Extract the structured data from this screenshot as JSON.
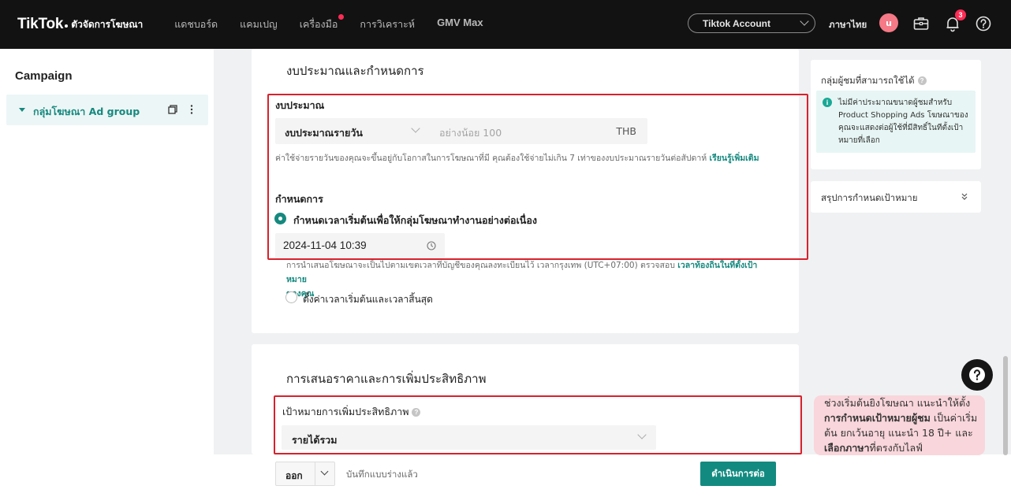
{
  "topbar": {
    "logo": "TikTok",
    "logo_sub": "ตัวจัดการโฆษณา",
    "nav": [
      "แดชบอร์ด",
      "แคมเปญ",
      "เครื่องมือ",
      "การวิเคราะห์",
      "GMV Max"
    ],
    "account": "Tiktok Account",
    "language": "ภาษาไทย",
    "avatar_initial": "u",
    "notification_count": "3"
  },
  "sidebar": {
    "title": "Campaign",
    "item_label": "กลุ่มโฆษณา Ad group"
  },
  "budget_section": {
    "title": "งบประมาณและกำหนดการ",
    "budget_label": "งบประมาณ",
    "budget_type": "งบประมาณรายวัน",
    "amount_placeholder": "อย่างน้อย 100",
    "currency": "THB",
    "budget_hint": "ค่าใช้จ่ายรายวันของคุณจะขึ้นอยู่กับโอกาสในการโฆษณาที่มี คุณต้องใช้จ่ายไม่เกิน 7 เท่าของงบประมาณรายวันต่อสัปดาห์",
    "learn_more": "เรียนรู้เพิ่มเติม",
    "schedule_label": "กำหนดการ",
    "radio_continuous": "กำหนดเวลาเริ่มต้นเพื่อให้กลุ่มโฆษณาทำงานอย่างต่อเนื่อง",
    "start_datetime": "2024-11-04 10:39",
    "timezone_hint": "การนำเสนอโฆษณาจะเป็นไปตามเขตเวลาที่บัญชีของคุณลงทะเบียนไว้ เวลากรุงเทพ (UTC+07:00) ตรวจสอบ",
    "timezone_link": "เวลาท้องถิ่นในที่ตั้งเป้าหมาย",
    "timezone_link2": "ของคุณ",
    "radio_start_end": "ตั้งค่าเวลาเริ่มต้นและเวลาสิ้นสุด"
  },
  "bidding_section": {
    "title": "การเสนอราคาและการเพิ่มประสิทธิภาพ",
    "goal_label": "เป้าหมายการเพิ่มประสิทธิภาพ",
    "goal_value": "รายได้รวม"
  },
  "footer": {
    "exit": "ออก",
    "draft_saved": "บันทึกแบบร่างแล้ว",
    "continue": "ดำเนินการต่อ"
  },
  "right_panel": {
    "audience_title": "กลุ่มผู้ชมที่สามารถใช้ได้",
    "audience_info": "ไม่มีค่าประมาณขนาดผู้ชมสำหรับ Product Shopping Ads โฆษณาของคุณจะแสดงต่อผู้ใช้ที่มีสิทธิ์ในทีตั้งเป้าหมายที่เลือก",
    "summary_title": "สรุปการกำหนดเป้าหมาย"
  },
  "tooltip": {
    "line1": "ช่วงเริ่มต้นยิงโฆษณา แนะนำให้ตั้ง",
    "bold1": "การกำหนดเป้าหมายผู้ชม",
    "line2": " เป็นค่าเริ่มต้น ยกเว้นอายุ แนะนำ 18 ปี+ และ",
    "bold2": "เลือกภาษา",
    "line3": "ที่ตรงกับไลฟ์"
  },
  "colors": {
    "accent": "#16897f",
    "highlight_border": "#d9212c",
    "tooltip_bg": "#f9d6db"
  }
}
